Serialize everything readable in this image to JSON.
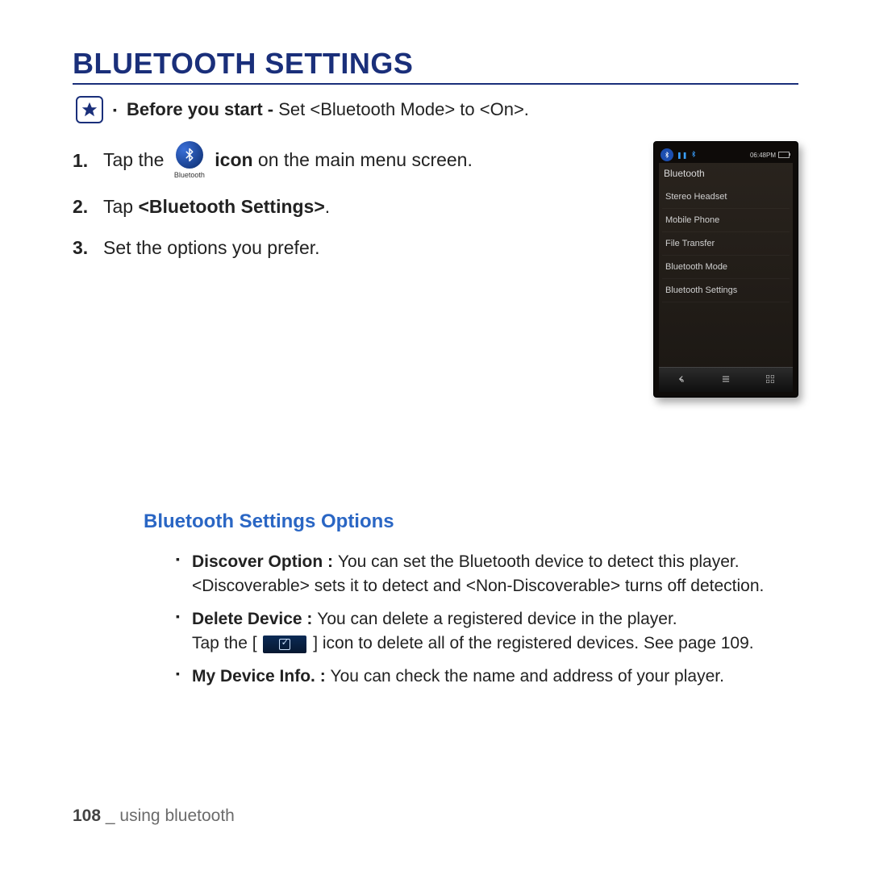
{
  "title": "BLUETOOTH SETTINGS",
  "note": {
    "label": "Before you start - ",
    "text": "Set <Bluetooth Mode> to <On>."
  },
  "steps": {
    "s1": {
      "num": "1.",
      "pre": "Tap the ",
      "iconCaption": "Bluetooth",
      "post": " icon",
      "tail": " on the main menu screen."
    },
    "s2": {
      "num": "2.",
      "pre": "Tap ",
      "bold": "<Bluetooth Settings>",
      "tail": "."
    },
    "s3": {
      "num": "3.",
      "text": "Set the options you prefer."
    }
  },
  "device": {
    "time": "06:48PM",
    "header": "Bluetooth",
    "items": [
      "Stereo Headset",
      "Mobile Phone",
      "File Transfer",
      "Bluetooth Mode",
      "Bluetooth Settings"
    ]
  },
  "subheading": "Bluetooth Settings Options",
  "options": {
    "o1": {
      "label": "Discover Option : ",
      "line1": "You can set the Bluetooth device to detect this player.",
      "line2": "<Discoverable> sets it to detect and <Non-Discoverable> turns off detection."
    },
    "o2": {
      "label": "Delete Device : ",
      "line1": "You can delete a registered device in the player.",
      "line2a": "Tap the [ ",
      "line2b": " ] icon to delete all of the registered devices. See page 109."
    },
    "o3": {
      "label": "My Device Info. : ",
      "text": "You can check the name and address of your player."
    }
  },
  "footer": {
    "page": "108",
    "sep": " _ ",
    "section": "using bluetooth"
  }
}
